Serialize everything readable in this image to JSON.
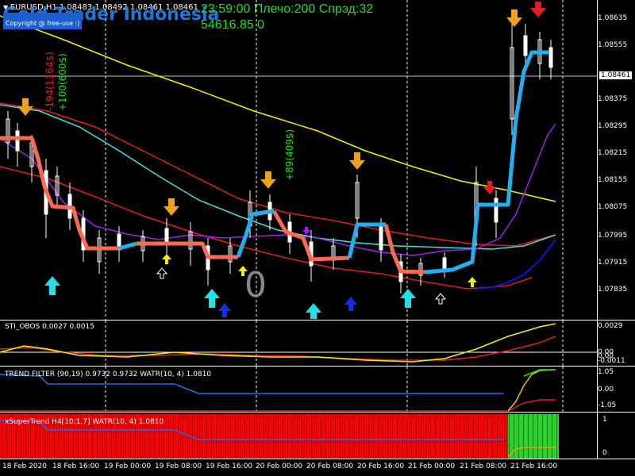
{
  "header": {
    "symbol_line": "EURUSD,H1  1.08483 1.08492 1.08461 1.08461",
    "watermark": "Gold Trader Indonesia",
    "copyright": "Copyright @ free-use :)",
    "hud_line1": "23:59:00 Плечо:200 Спрэд:32",
    "hud_line2": "54616.85 0"
  },
  "main_chart": {
    "price_ticks": [
      "1.08635",
      "1.08555",
      "1.08375",
      "1.08295",
      "1.08215",
      "1.08155",
      "1.08075",
      "1.07995",
      "1.07915",
      "1.07835"
    ],
    "current_price": "1.08461",
    "big_zero": "0",
    "annotations": {
      "loss_text": "-194(1164$)",
      "gain_text": "+100(600$)",
      "gain_text2": "+89(409$)"
    }
  },
  "indicators": {
    "sti_obos": {
      "label": "STI_OBOS 0.0027 0.0015",
      "ticks": [
        "0.0029",
        "0.00",
        "0.00",
        "-0.0011"
      ]
    },
    "trend_filter": {
      "label": "TREND FILTER (90,19) 0.9732 0.9732  WATR(10, 4) 1.0810",
      "ticks": [
        "1.05",
        "0.00",
        "-1.05"
      ]
    },
    "xsupertrend": {
      "label": "xSuperTrend H4[10;1.7]  WATR(10, 4) 1.0810",
      "ticks": [
        "1",
        "0"
      ]
    }
  },
  "time_axis": [
    "18 Feb 2020",
    "18 Feb 16:00",
    "19 Feb 00:00",
    "19 Feb 08:00",
    "19 Feb 16:00",
    "20 Feb 00:00",
    "20 Feb 08:00",
    "20 Feb 16:00",
    "21 Feb 00:00",
    "21 Feb 08:00",
    "21 Feb 16:00"
  ],
  "colors": {
    "background": "#000000",
    "grid": "#ffffff",
    "yellow_ma": "#f2f200",
    "red_ma": "#dd2020",
    "cyan_ma": "#40e0e0",
    "purple_ma": "#a020f0",
    "blue_ma": "#1010e0",
    "salmon_trend": "#fa6a50",
    "sky_trend": "#20b0f0",
    "hud_green": "#19e519",
    "histogram_red": "#ff0000",
    "histogram_green": "#33cc33"
  }
}
